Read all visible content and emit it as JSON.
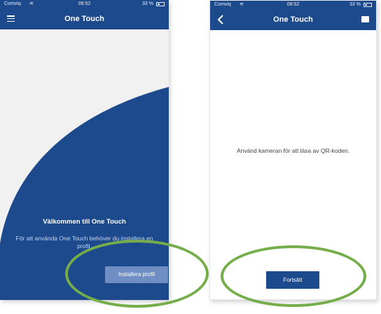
{
  "left_screen": {
    "status_bar": {
      "carrier": "Comviq",
      "time": "08:52",
      "battery": "33 %"
    },
    "nav_bar": {
      "title": "One Touch",
      "left_icon": "menu-icon"
    },
    "welcome": {
      "title": "Välkommen till One Touch",
      "text": "För att använda One Touch behöver du installera en profil.",
      "button_label": "Installera profil"
    }
  },
  "right_screen": {
    "status_bar": {
      "carrier": "Comviq",
      "time": "08:52",
      "battery": "33 %"
    },
    "nav_bar": {
      "title": "One Touch",
      "left_icon": "back-chevron-icon",
      "right_icon": "keyboard-icon"
    },
    "instruction": "Använd kameran för att läsa av QR-koden.",
    "button_label": "Fortsätt"
  },
  "colors": {
    "primary_blue": "#1d4a8c",
    "install_button": "#6f8fc4",
    "annotation_green": "#74ad4a",
    "background_gray": "#f1f1f1"
  }
}
